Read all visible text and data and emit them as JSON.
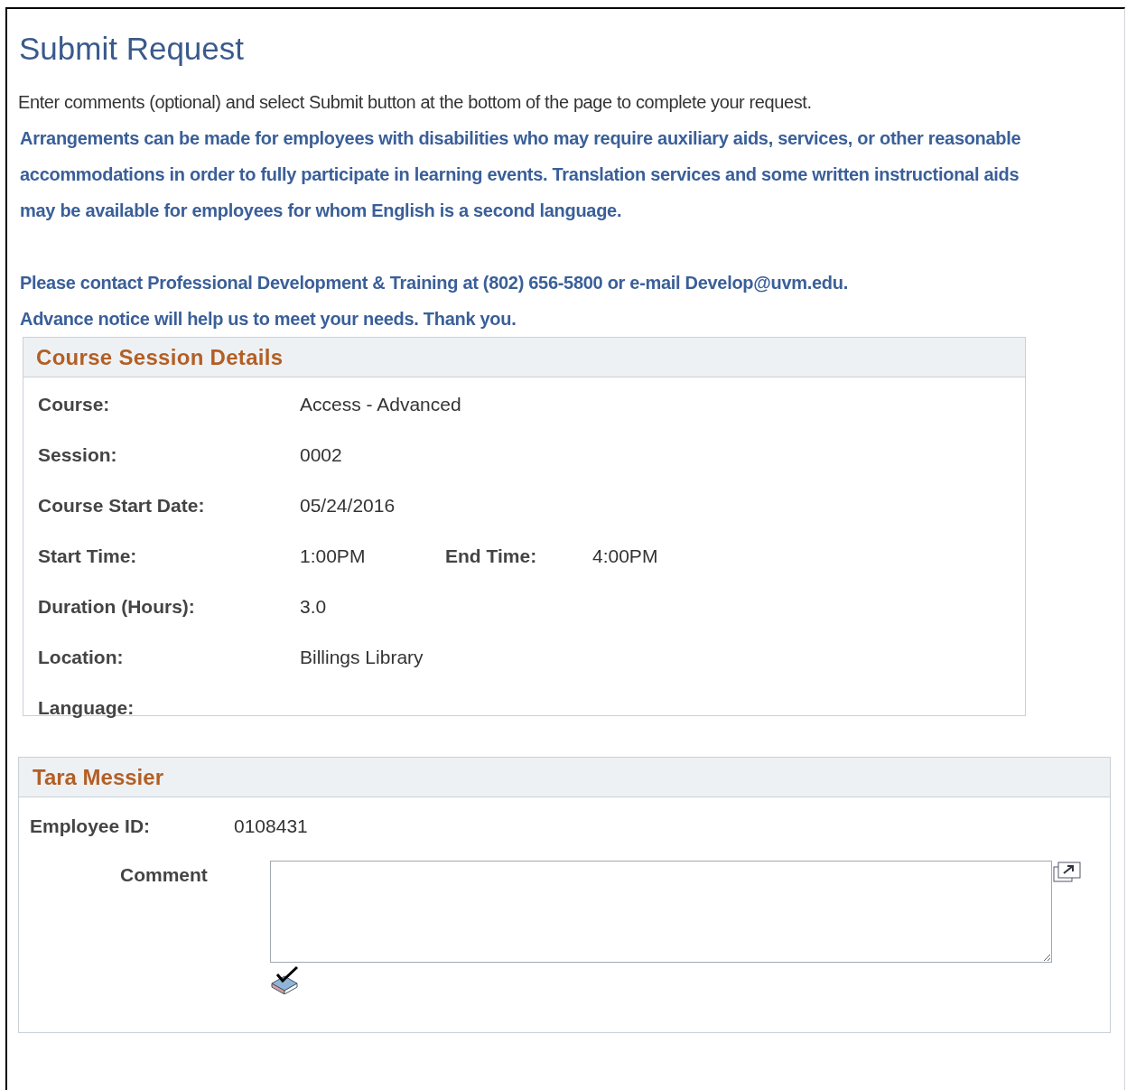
{
  "page": {
    "title": "Submit Request"
  },
  "instructions": "Enter comments (optional) and select Submit button at the bottom of the page to complete your request.",
  "notices": [
    "Arrangements can be made for employees with disabilities who may require auxiliary aids, services, or other reasonable accommodations in order to fully participate in learning events. Translation services and some written instructional aids may be available for employees for whom English is a second language.",
    "Please contact Professional Development & Training at (802) 656-5800 or e-mail Develop@uvm.edu. Advance notice will help us to meet your needs. Thank you."
  ],
  "course_section": {
    "title": "Course Session Details",
    "rows": [
      [
        {
          "label": "Course:",
          "value": "Access - Advanced"
        }
      ],
      [
        {
          "label": "Session:",
          "value": "0002"
        }
      ],
      [
        {
          "label": "Course Start Date:",
          "value": "05/24/2016"
        }
      ],
      [
        {
          "label": "Start Time:",
          "value": "1:00PM"
        },
        {
          "label": "End Time:",
          "value": "4:00PM"
        }
      ],
      [
        {
          "label": "Duration (Hours):",
          "value": "3.0"
        }
      ],
      [
        {
          "label": "Location:",
          "value": "Billings Library"
        }
      ],
      [
        {
          "label": "Language:"
        }
      ]
    ]
  },
  "employee_section": {
    "title": "Tara Messier",
    "employee_id_label": "Employee ID:",
    "employee_id": "0108431",
    "comment_label": "Comment"
  }
}
